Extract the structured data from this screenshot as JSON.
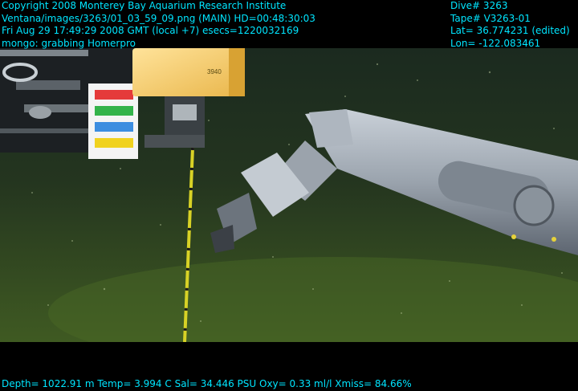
{
  "overlay": {
    "top_left": [
      "Copyright 2008 Monterey Bay Aquarium Research Institute",
      "Ventana/images/3263/01_03_59_09.png (MAIN)  HD=00:48:30:03",
      "Fri Aug 29 17:49:29 2008 GMT (local +7)  esecs=1220032169",
      "mongo: grabbing Homerpro"
    ],
    "top_right": [
      "Dive# 3263",
      "Tape# V3263-01",
      "Lat= 36.774231 (edited)",
      "Lon= -122.083461"
    ],
    "bottom": "Depth= 1022.91 m  Temp= 3.994 C  Sal= 34.446 PSU  Oxy= 0.33 ml/l  Xmiss= 84.66%"
  },
  "scene": {
    "box_label": "3940",
    "overlay_text_color": "#00e5ff"
  }
}
